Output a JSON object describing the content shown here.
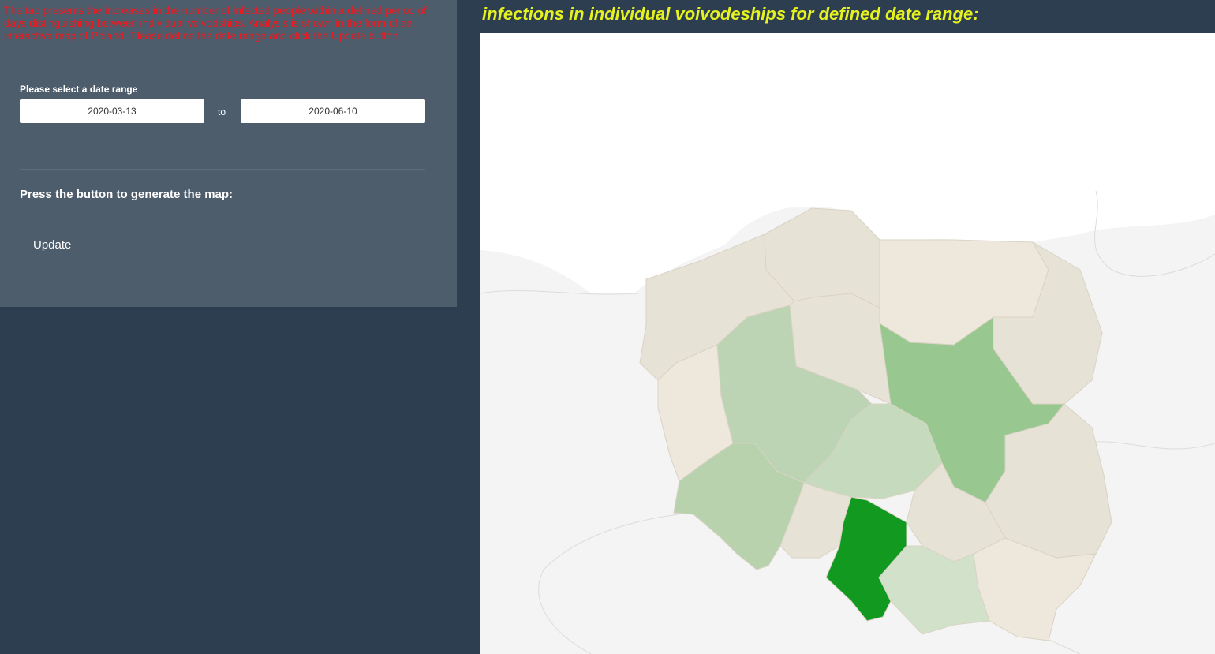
{
  "sidebar": {
    "intro_text": "The tab presents the increases in the number of infected people within a defined period of days distinguishing between individual voivodships. Analysis is shown in the form of an interactive map of Poland. Please define the date range and click the Update button.",
    "date_range_label": "Please select a date range",
    "date_start": "2020-03-13",
    "date_separator": "to",
    "date_end": "2020-06-10",
    "press_label": "Press the button to generate the map:",
    "update_button": "Update"
  },
  "main": {
    "title": "infections in individual voivodeships for defined date range:"
  },
  "colors": {
    "intro_text": "#e8191f",
    "title": "#e6f21f",
    "sidebar_bg": "#4e5d6c",
    "page_bg": "#2c3e50",
    "map_land": "#f4f4f4",
    "map_sea": "#ffffff",
    "highest": "#12991f"
  }
}
